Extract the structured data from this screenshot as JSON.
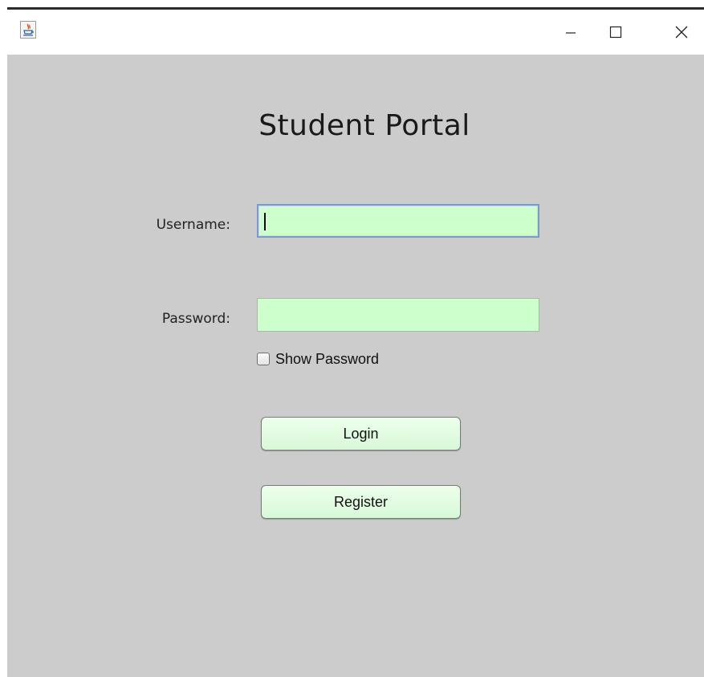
{
  "window": {
    "icon": "java-icon",
    "controls": {
      "minimize": "minimize-icon",
      "maximize": "maximize-icon",
      "close": "close-icon"
    }
  },
  "form": {
    "title": "Student Portal",
    "username_label": "Username:",
    "username_value": "",
    "password_label": "Password:",
    "password_value": "",
    "show_password_label": "Show Password",
    "show_password_checked": false,
    "login_label": "Login",
    "register_label": "Register"
  },
  "colors": {
    "background": "#cccccc",
    "field_fill": "#ccffcc",
    "button_fill": "#ddfadd",
    "focus_border": "#7a9cc6"
  }
}
